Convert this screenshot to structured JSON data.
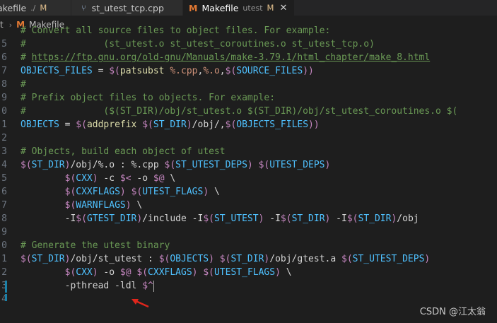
{
  "tabs": [
    {
      "name": "akefile",
      "path": "./",
      "dirty": "M",
      "active": false
    },
    {
      "name": "st_utest_tcp.cpp",
      "active": false
    },
    {
      "name": "Makefile",
      "description": "utest",
      "dirty": "M",
      "active": true
    }
  ],
  "breadcrumb": {
    "prefix": "t",
    "file": "Makefile"
  },
  "editor": {
    "lines": [
      {
        "n": "",
        "html": "<span class=\"c\"># Convert all source files to object files. For example:</span>"
      },
      {
        "n": "5",
        "html": "<span class=\"c\">#              (st_utest.o st_utest_coroutines.o st_utest_tcp.o)</span>"
      },
      {
        "n": "6",
        "html": "<span class=\"c\"># </span><span class=\"u\">https://ftp.gnu.org/old-gnu/Manuals/make-3.79.1/html_chapter/make_8.html</span>"
      },
      {
        "n": "7",
        "html": "<span class=\"v\">OBJECTS_FILES</span> = <span class=\"k\">$(</span><span class=\"m\">patsubst</span> <span class=\"s\">%.cpp</span>,<span class=\"s\">%.o</span>,<span class=\"k\">$(</span><span class=\"v\">SOURCE_FILES</span><span class=\"k\">))</span>"
      },
      {
        "n": "8",
        "html": "<span class=\"c\">#</span>"
      },
      {
        "n": "9",
        "html": "<span class=\"c\"># Prefix object files to objects. For example:</span>"
      },
      {
        "n": "0",
        "html": "<span class=\"c\">#              ($(ST_DIR)/obj/st_utest.o $(ST_DIR)/obj/st_utest_coroutines.o $(</span>"
      },
      {
        "n": "1",
        "html": "<span class=\"v\">OBJECTS</span> = <span class=\"k\">$(</span><span class=\"m\">addprefix</span> <span class=\"k\">$(</span><span class=\"v\">ST_DIR</span><span class=\"k\">)</span>/obj/,<span class=\"k\">$(</span><span class=\"v\">OBJECTS_FILES</span><span class=\"k\">))</span>"
      },
      {
        "n": "2",
        "html": ""
      },
      {
        "n": "3",
        "html": "<span class=\"c\"># Objects, build each object of utest</span>"
      },
      {
        "n": "4",
        "html": "<span class=\"k\">$(</span><span class=\"v\">ST_DIR</span><span class=\"k\">)</span>/obj/%.o : %.cpp <span class=\"k\">$(</span><span class=\"v\">ST_UTEST_DEPS</span><span class=\"k\">)</span> <span class=\"k\">$(</span><span class=\"v\">UTEST_DEPS</span><span class=\"k\">)</span>"
      },
      {
        "n": "5",
        "html": "        <span class=\"k\">$(</span><span class=\"v\">CXX</span><span class=\"k\">)</span> -c <span class=\"k\">$&lt;</span> -o <span class=\"k\">$@</span> \\"
      },
      {
        "n": "6",
        "html": "        <span class=\"k\">$(</span><span class=\"v\">CXXFLAGS</span><span class=\"k\">)</span> <span class=\"k\">$(</span><span class=\"v\">UTEST_FLAGS</span><span class=\"k\">)</span> \\"
      },
      {
        "n": "7",
        "html": "        <span class=\"k\">$(</span><span class=\"v\">WARNFLAGS</span><span class=\"k\">)</span> \\"
      },
      {
        "n": "8",
        "html": "        -I<span class=\"k\">$(</span><span class=\"v\">GTEST_DIR</span><span class=\"k\">)</span>/include -I<span class=\"k\">$(</span><span class=\"v\">ST_UTEST</span><span class=\"k\">)</span> -I<span class=\"k\">$(</span><span class=\"v\">ST_DIR</span><span class=\"k\">)</span> -I<span class=\"k\">$(</span><span class=\"v\">ST_DIR</span><span class=\"k\">)</span>/obj"
      },
      {
        "n": "9",
        "html": ""
      },
      {
        "n": "0",
        "html": "<span class=\"c\"># Generate the utest binary</span>"
      },
      {
        "n": "1",
        "html": "<span class=\"k\">$(</span><span class=\"v\">ST_DIR</span><span class=\"k\">)</span>/obj/st_utest : <span class=\"k\">$(</span><span class=\"v\">OBJECTS</span><span class=\"k\">)</span> <span class=\"k\">$(</span><span class=\"v\">ST_DIR</span><span class=\"k\">)</span>/obj/gtest.a <span class=\"k\">$(</span><span class=\"v\">ST_UTEST_DEPS</span><span class=\"k\">)</span>"
      },
      {
        "n": "2",
        "html": "        <span class=\"k\">$(</span><span class=\"v\">CXX</span><span class=\"k\">)</span> -o <span class=\"k\">$@</span> <span class=\"k\">$(</span><span class=\"v\">CXXFLAGS</span><span class=\"k\">)</span> <span class=\"k\">$(</span><span class=\"v\">UTEST_FLAGS</span><span class=\"k\">)</span> \\"
      },
      {
        "n": "3",
        "html": "        -pthread -ldl <span class=\"k\">$^</span><span class=\"cursor\"></span>"
      },
      {
        "n": "4",
        "html": ""
      }
    ]
  },
  "watermark": "CSDN @江太翁",
  "colors": {
    "accent_arrow": "#e0261c",
    "tab_dirty": "#e2c08d",
    "makefile_icon": "#e37933"
  }
}
